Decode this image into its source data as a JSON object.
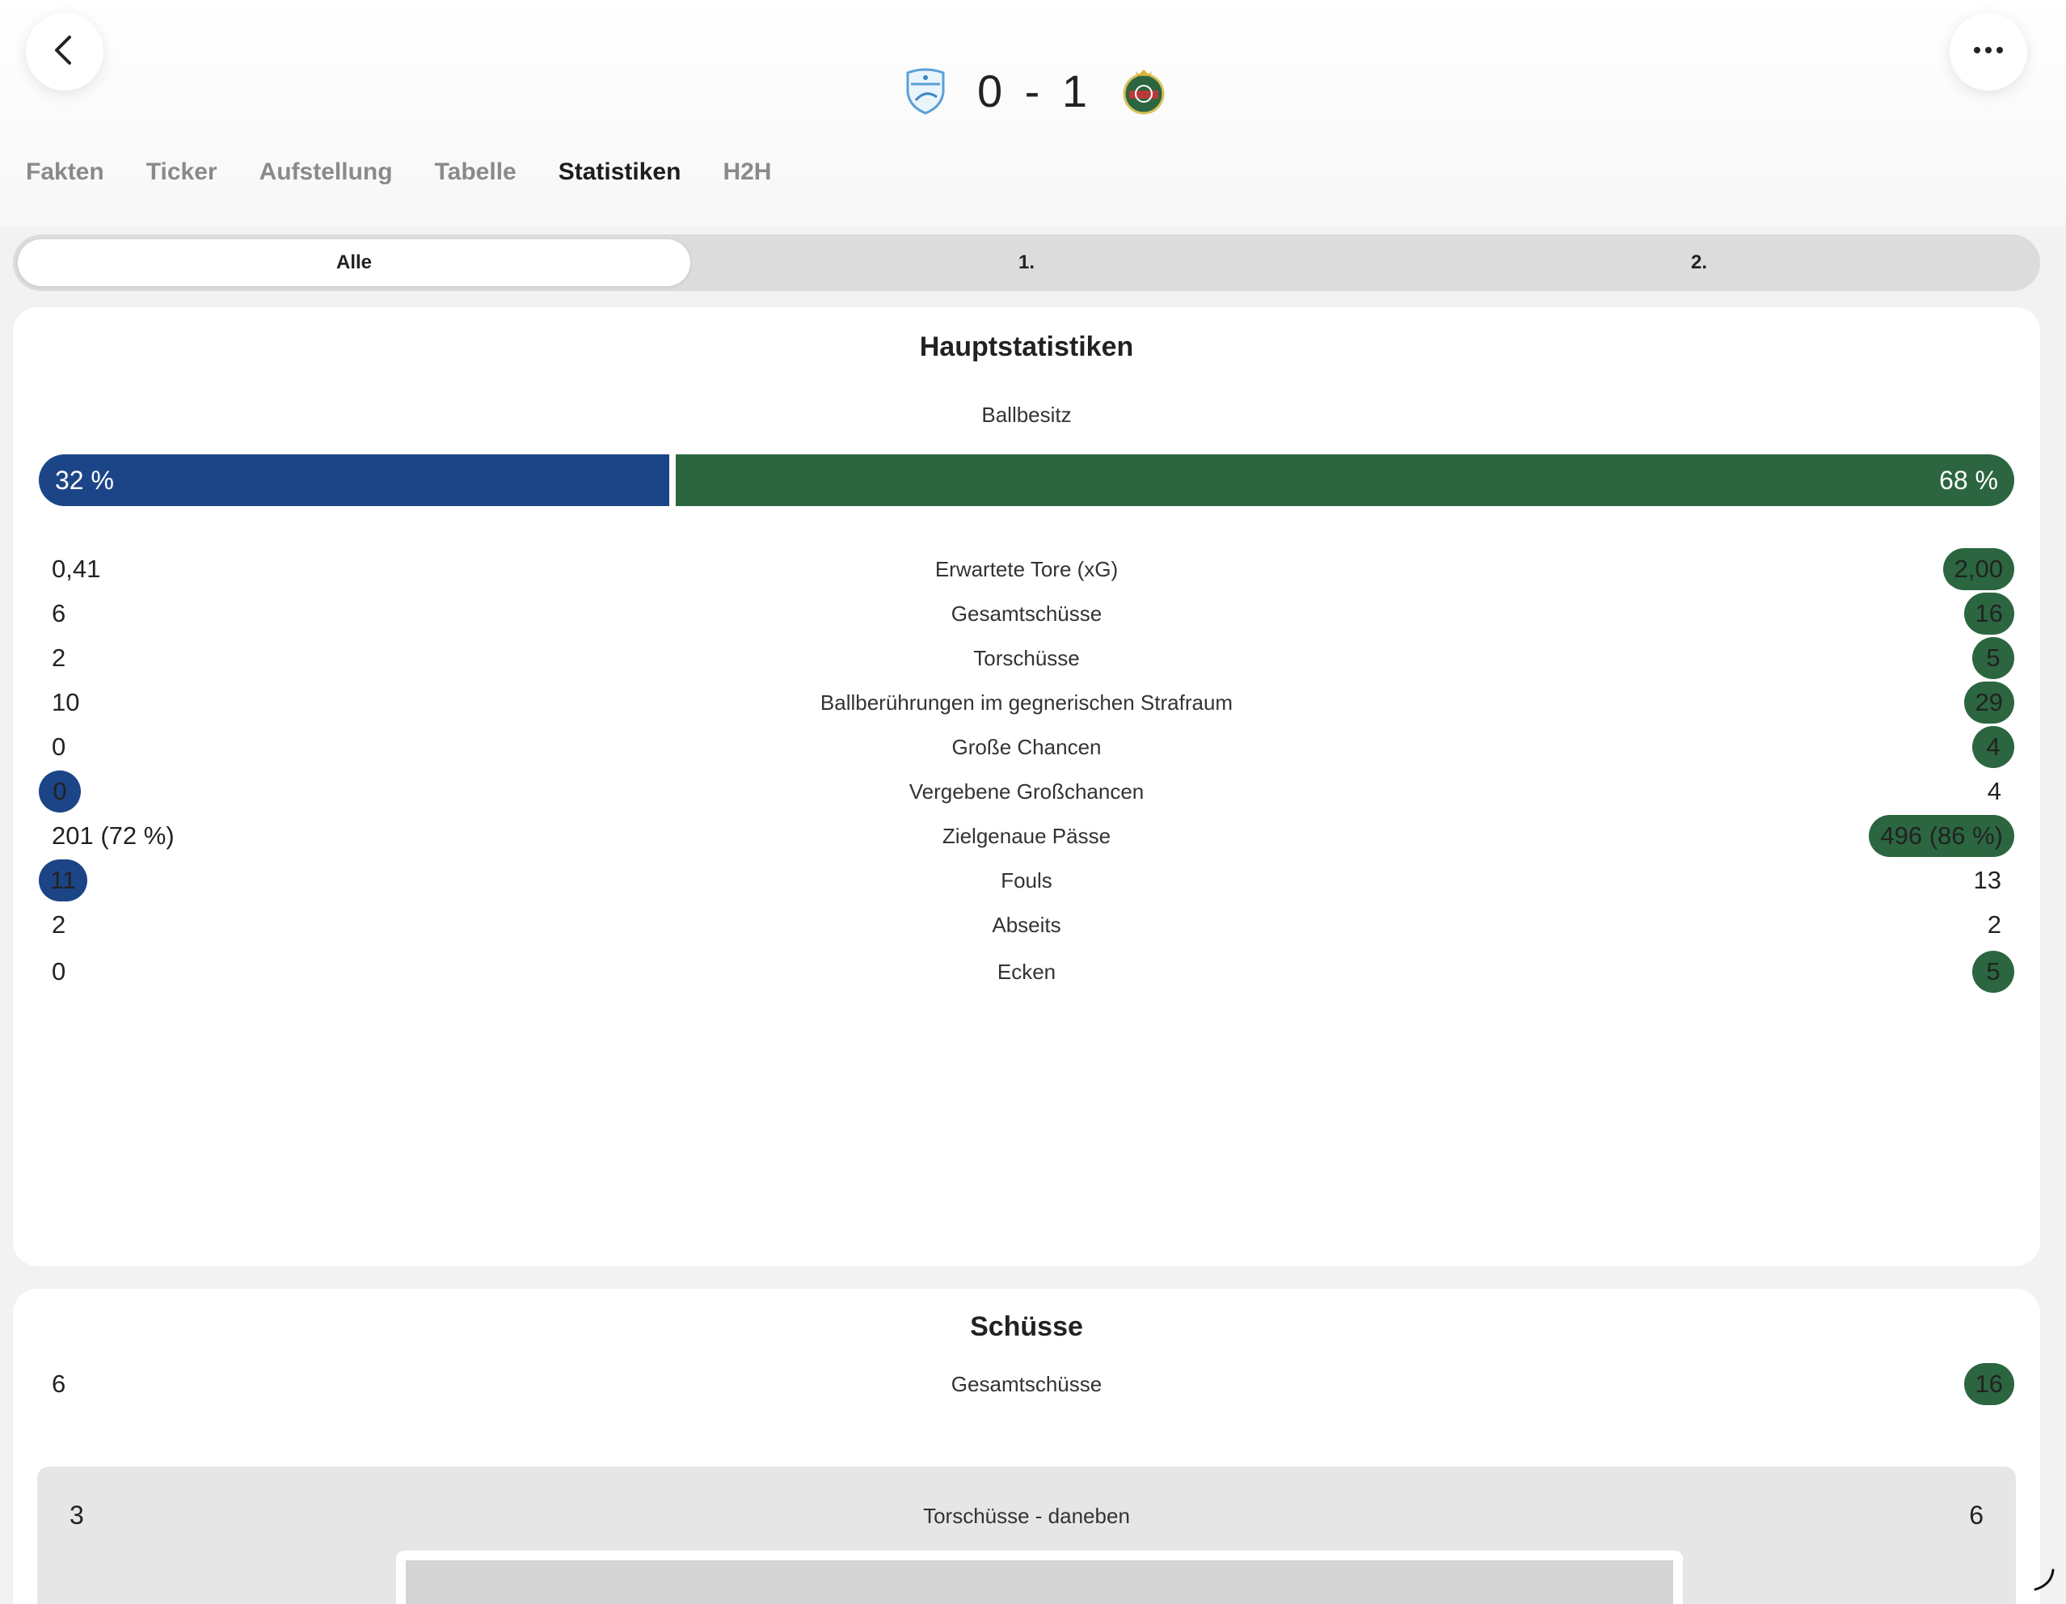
{
  "match": {
    "score": "0 - 1",
    "home_crest": "tsv-hartberg-crest",
    "away_crest": "rapid-wien-crest"
  },
  "tabs": [
    "Fakten",
    "Ticker",
    "Aufstellung",
    "Tabelle",
    "Statistiken",
    "H2H"
  ],
  "active_tab": "Statistiken",
  "periods": [
    "Alle",
    "1.",
    "2."
  ],
  "active_period": "Alle",
  "colors": {
    "home": "#1c4587",
    "away": "#2b6640"
  },
  "main_stats": {
    "title": "Hauptstatistiken",
    "possession": {
      "label": "Ballbesitz",
      "home": "32 %",
      "away": "68 %",
      "home_share": 0.32
    },
    "rows": [
      {
        "label": "Erwartete Tore (xG)",
        "home": "0,41",
        "away": "2,00",
        "highlight": "away"
      },
      {
        "label": "Gesamtschüsse",
        "home": "6",
        "away": "16",
        "highlight": "away"
      },
      {
        "label": "Torschüsse",
        "home": "2",
        "away": "5",
        "highlight": "away"
      },
      {
        "label": "Ballberührungen im gegnerischen Strafraum",
        "home": "10",
        "away": "29",
        "highlight": "away"
      },
      {
        "label": "Große Chancen",
        "home": "0",
        "away": "4",
        "highlight": "away"
      },
      {
        "label": "Vergebene Großchancen",
        "home": "0",
        "away": "4",
        "highlight": "home"
      },
      {
        "label": "Zielgenaue Pässe",
        "home": "201 (72 %)",
        "away": "496 (86 %)",
        "highlight": "away"
      },
      {
        "label": "Fouls",
        "home": "11",
        "away": "13",
        "highlight": "home"
      },
      {
        "label": "Abseits",
        "home": "2",
        "away": "2",
        "highlight": "none"
      },
      {
        "label": "Ecken",
        "home": "0",
        "away": "5",
        "highlight": "away"
      }
    ]
  },
  "shots": {
    "title": "Schüsse",
    "total": {
      "label": "Gesamtschüsse",
      "home": "6",
      "away": "16",
      "highlight": "away"
    },
    "off_target": {
      "label": "Torschüsse - daneben",
      "home": "3",
      "away": "6"
    }
  }
}
